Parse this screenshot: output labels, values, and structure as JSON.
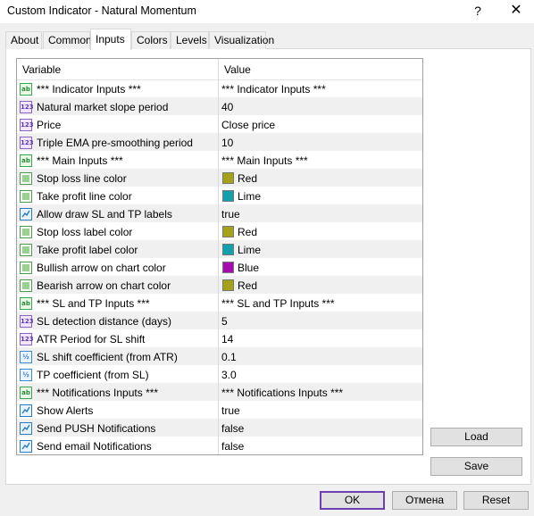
{
  "window": {
    "title": "Custom Indicator - Natural Momentum",
    "help_glyph": "?",
    "close_glyph": "✕"
  },
  "tabs": [
    {
      "label": "About"
    },
    {
      "label": "Common"
    },
    {
      "label": "Inputs"
    },
    {
      "label": "Colors"
    },
    {
      "label": "Levels"
    },
    {
      "label": "Visualization"
    }
  ],
  "active_tab": "Inputs",
  "grid": {
    "headers": {
      "variable": "Variable",
      "value": "Value"
    },
    "rows": [
      {
        "type": "string",
        "icon": "string-icon",
        "variable": "*** Indicator Inputs ***",
        "value": "*** Indicator Inputs ***"
      },
      {
        "type": "int",
        "icon": "integer-icon",
        "variable": "Natural market slope period",
        "value": "40"
      },
      {
        "type": "int",
        "icon": "integer-icon",
        "variable": "Price",
        "value": "Close price"
      },
      {
        "type": "int",
        "icon": "integer-icon",
        "variable": "Triple EMA pre-smoothing period",
        "value": "10"
      },
      {
        "type": "string",
        "icon": "string-icon",
        "variable": "*** Main Inputs ***",
        "value": "*** Main Inputs ***"
      },
      {
        "type": "color",
        "icon": "color-icon",
        "variable": "Stop loss line color",
        "value": "Red",
        "swatch": "#a5a21a"
      },
      {
        "type": "color",
        "icon": "color-icon",
        "variable": "Take profit line color",
        "value": "Lime",
        "swatch": "#12a0ac"
      },
      {
        "type": "bool",
        "icon": "boolean-icon",
        "variable": "Allow draw SL and TP labels",
        "value": "true"
      },
      {
        "type": "color",
        "icon": "color-icon",
        "variable": "Stop loss label color",
        "value": "Red",
        "swatch": "#a5a21a"
      },
      {
        "type": "color",
        "icon": "color-icon",
        "variable": "Take profit label color",
        "value": "Lime",
        "swatch": "#12a0ac"
      },
      {
        "type": "color",
        "icon": "color-icon",
        "variable": "Bullish arrow on chart color",
        "value": "Blue",
        "swatch": "#a60bb0"
      },
      {
        "type": "color",
        "icon": "color-icon",
        "variable": "Bearish arrow on chart color",
        "value": "Red",
        "swatch": "#a5a21a"
      },
      {
        "type": "string",
        "icon": "string-icon",
        "variable": "*** SL and TP Inputs ***",
        "value": "*** SL and TP Inputs ***"
      },
      {
        "type": "int",
        "icon": "integer-icon",
        "variable": "SL detection distance (days)",
        "value": "5"
      },
      {
        "type": "int",
        "icon": "integer-icon",
        "variable": "ATR Period for SL shift",
        "value": "14"
      },
      {
        "type": "double",
        "icon": "double-icon",
        "variable": "SL shift coefficient (from ATR)",
        "value": "0.1"
      },
      {
        "type": "double",
        "icon": "double-icon",
        "variable": "TP coefficient (from SL)",
        "value": "3.0"
      },
      {
        "type": "string",
        "icon": "string-icon",
        "variable": "*** Notifications Inputs ***",
        "value": "*** Notifications Inputs ***"
      },
      {
        "type": "bool",
        "icon": "boolean-icon",
        "variable": "Show Alerts",
        "value": "true"
      },
      {
        "type": "bool",
        "icon": "boolean-icon",
        "variable": "Send PUSH Notifications",
        "value": "false"
      },
      {
        "type": "bool",
        "icon": "boolean-icon",
        "variable": "Send email Notifications",
        "value": "false"
      }
    ]
  },
  "buttons": {
    "load": "Load",
    "save": "Save",
    "ok": "OK",
    "cancel": "Отмена",
    "reset": "Reset"
  },
  "icon_glyphs": {
    "string": "ab",
    "int": "123",
    "double": "½"
  }
}
